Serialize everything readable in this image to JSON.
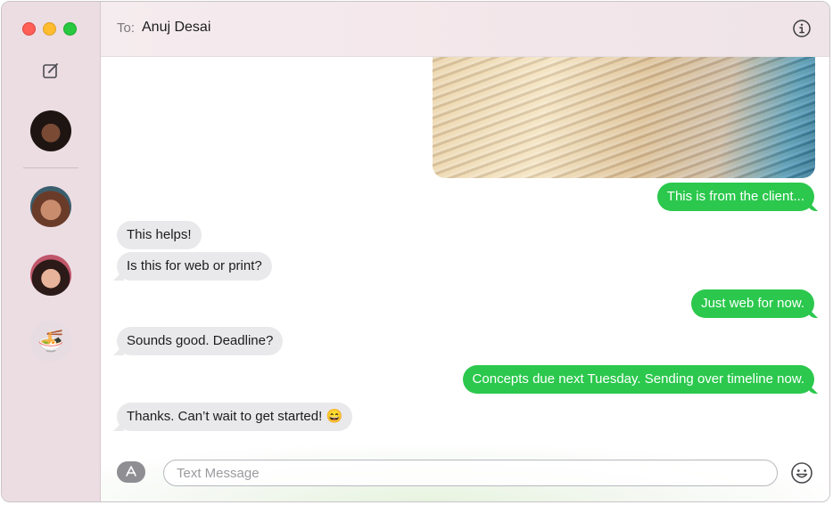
{
  "sidebar": {
    "contacts": [
      {
        "name": "contact-1"
      },
      {
        "name": "contact-2"
      },
      {
        "name": "contact-3"
      },
      {
        "name": "contact-4",
        "emoji": "🍜"
      }
    ]
  },
  "header": {
    "to_label": "To:",
    "recipient": "Anuj Desai"
  },
  "messages": [
    {
      "from": "me",
      "text": "This is from the client..."
    },
    {
      "from": "them",
      "text": "This helps!"
    },
    {
      "from": "them",
      "text": "Is this for web or print?"
    },
    {
      "from": "me",
      "text": "Just web for now."
    },
    {
      "from": "them",
      "text": "Sounds good. Deadline?"
    },
    {
      "from": "me",
      "text": "Concepts due next Tuesday. Sending over timeline now."
    },
    {
      "from": "them",
      "text": "Thanks. Can’t wait to get started! 😄"
    }
  ],
  "composer": {
    "placeholder": "Text Message",
    "value": ""
  },
  "colors": {
    "sent_bubble": "#2bc84d",
    "received_bubble": "#e9e9eb",
    "sidebar": "#ecdde3"
  }
}
